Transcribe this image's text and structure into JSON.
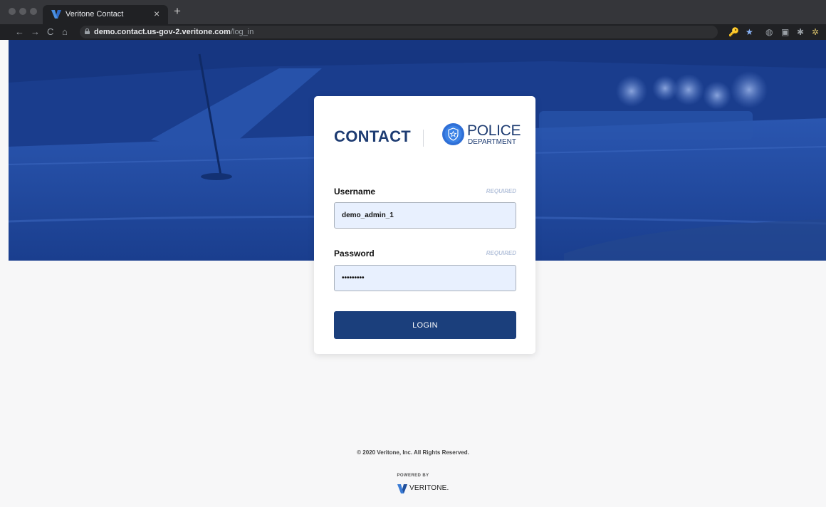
{
  "browser": {
    "tab_title": "Veritone Contact",
    "tab_close": "×",
    "new_tab": "+",
    "url_host": "demo.contact.us-gov-2.veritone.com",
    "url_path": "/log_in",
    "nav": {
      "back": "←",
      "forward": "→",
      "reload": "C",
      "home": "⌂"
    },
    "extensions": {
      "key": "🔑",
      "bookmark_star": "★",
      "extension_1": "◍",
      "extension_2": "▣",
      "puzzle": "✱",
      "profile": "✲"
    }
  },
  "login": {
    "brand": "CONTACT",
    "partner_top": "POLICE",
    "partner_bottom": "DEPARTMENT",
    "username_label": "Username",
    "username_required": "REQUIRED",
    "username_value": "demo_admin_1",
    "password_label": "Password",
    "password_required": "REQUIRED",
    "password_value": "•••••••••",
    "login_button": "LOGIN"
  },
  "footer": {
    "copyright": "© 2020 Veritone, Inc. All Rights Reserved.",
    "powered_by": "POWERED BY",
    "company": "VERITONE."
  },
  "colors": {
    "primary": "#1b3f7c",
    "hero": "#1f4496",
    "field_bg": "#e8f0fe",
    "required": "#b7c4dc"
  },
  "icons": {
    "favicon": "veritone-v-icon",
    "badge": "police-badge-icon",
    "lock": "lock-icon"
  }
}
